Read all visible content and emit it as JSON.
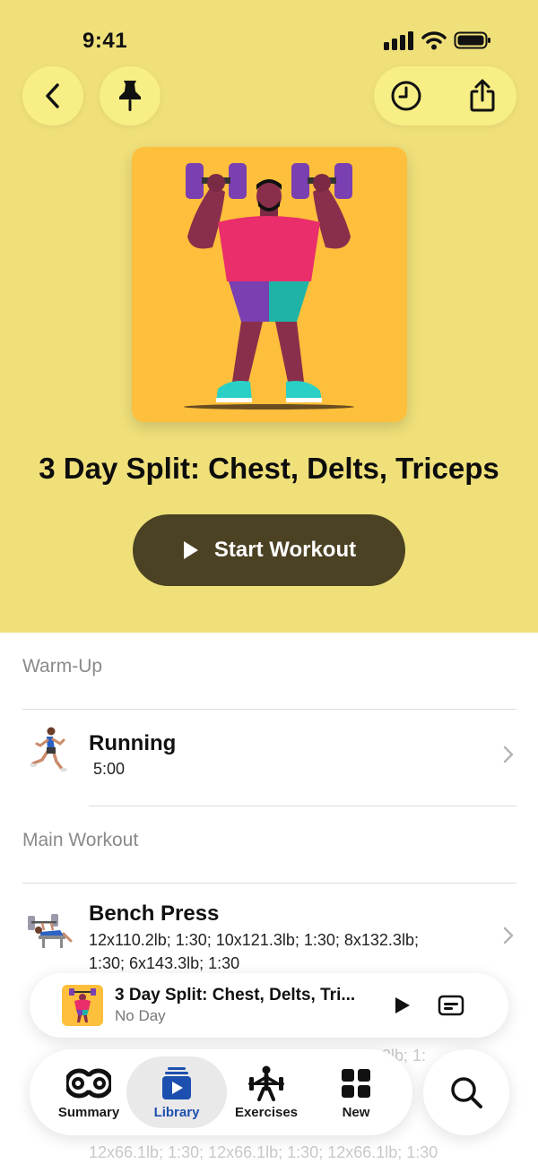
{
  "status_bar": {
    "time": "9:41"
  },
  "header": {
    "back_icon": "chevron-left-icon",
    "pin_icon": "pin-icon",
    "history_icon": "clock-icon",
    "share_icon": "share-icon"
  },
  "workout": {
    "title": "3 Day Split: Chest, Delts, Triceps",
    "start_label": "Start Workout"
  },
  "sections": {
    "warmup": "Warm-Up",
    "main": "Main Workout"
  },
  "exercises": [
    {
      "name": "Running",
      "detail": "5:00"
    },
    {
      "name": "Bench Press",
      "detail": "12x110.2lb; 1:30; 10x121.3lb; 1:30; 8x132.3lb; 1:30; 6x143.3lb; 1:30"
    }
  ],
  "partial": {
    "row3_tail": "2lb; 1:",
    "row4_detail": "12x66.1lb; 1:30; 12x66.1lb; 1:30; 12x66.1lb; 1:30"
  },
  "mini_player": {
    "title": "3 Day Split: Chest, Delts, Tri...",
    "subtitle": "No Day"
  },
  "tabs": [
    {
      "label": "Summary",
      "icon": "rings-icon"
    },
    {
      "label": "Library",
      "icon": "library-icon",
      "active": true
    },
    {
      "label": "Exercises",
      "icon": "weightlifter-icon"
    },
    {
      "label": "New",
      "icon": "grid-icon"
    }
  ],
  "colors": {
    "hero_bg": "#efe07a",
    "button_bg": "#f7ee85",
    "start_button": "#4b4123",
    "active_tab": "#1d4fae"
  }
}
